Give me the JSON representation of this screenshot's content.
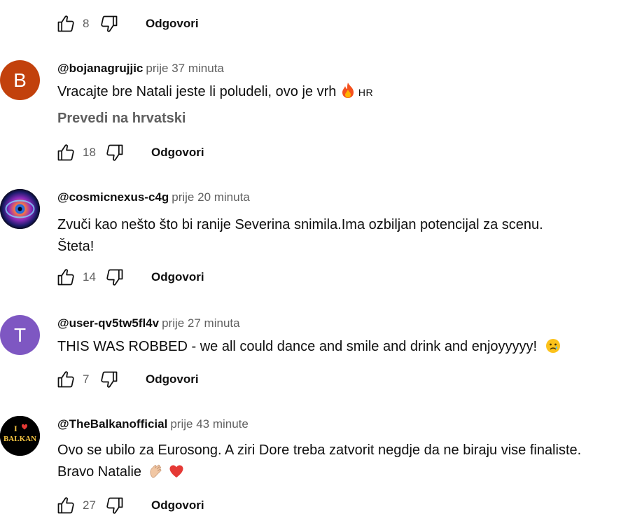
{
  "top_actions": {
    "like_count": "8",
    "reply_label": "Odgovori"
  },
  "comments": [
    {
      "avatar_letter": "B",
      "avatar_color": "#c2410c",
      "author": "@bojanagrujjic",
      "time": "prije 37 minuta",
      "lines": [
        "Vracajte bre Natali jeste li poludeli, ovo je vrh"
      ],
      "trailing_emoji": "fire-emoji",
      "lang_tag": "HR",
      "translate_label": "Prevedi na hrvatski",
      "like_count": "18",
      "reply_label": "Odgovori"
    },
    {
      "avatar_image": "galaxy-eye",
      "author": "@cosmicnexus-c4g",
      "time": "prije 20 minuta",
      "lines": [
        "Zvuči kao nešto što bi ranije Severina snimila.Ima ozbiljan potencijal za scenu.",
        "Šteta!"
      ],
      "like_count": "14",
      "reply_label": "Odgovori"
    },
    {
      "avatar_letter": "T",
      "avatar_color": "#7e57c2",
      "author": "@user-qv5tw5fl4v",
      "time": "prije 27 minuta",
      "lines": [
        "THIS WAS ROBBED - we all could dance and smile and drink and enjoyyyyy!"
      ],
      "trailing_emoji": "crying-face-emoji",
      "like_count": "7",
      "reply_label": "Odgovori"
    },
    {
      "avatar_image": "i-love-balkan-logo",
      "avatar_text": [
        "I",
        "BALKAN"
      ],
      "author": "@TheBalkanofficial",
      "time": "prije 43 minute",
      "lines": [
        "Ovo se ubilo za Eurosong. A ziri Dore treba zatvorit negdje da ne biraju vise finaliste.",
        "Bravo Natalie"
      ],
      "trailing_emojis": [
        "clapping-hands-emoji",
        "red-heart-emoji"
      ],
      "like_count": "27",
      "reply_label": "Odgovori"
    }
  ]
}
